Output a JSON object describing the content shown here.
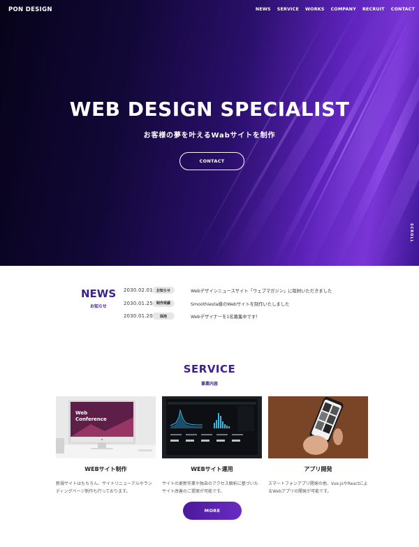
{
  "header": {
    "logo": "PON DESIGN",
    "nav": [
      "NEWS",
      "SERVICE",
      "WORKS",
      "COMPANY",
      "RECRUIT",
      "CONTACT"
    ]
  },
  "hero": {
    "title": "WEB DESIGN SPECIALIST",
    "subtitle": "お客様の夢を叶えるWabサイトを制作",
    "button": "CONTACT",
    "scroll": "SCROLL"
  },
  "news": {
    "title": "NEWS",
    "subtitle": "お知らせ",
    "items": [
      {
        "date": "2030.02.01",
        "tag": "お知らせ",
        "text": "Webデザインニュースサイト「ウェブマガジン」に取材いただきました"
      },
      {
        "date": "2030.01.25",
        "tag": "制作実績",
        "text": "Smoothiesta様のWebサイトを制作いたしました"
      },
      {
        "date": "2030.01.20",
        "tag": "採用",
        "text": "Webデザイナーを1名募集中です！"
      }
    ]
  },
  "service": {
    "title": "SERVICE",
    "subtitle": "事業内容",
    "cards": [
      {
        "image_text_1": "Web",
        "image_text_2": "Conference",
        "title": "WEBサイト制作",
        "text": "新規サイトはもちろん、サイトリニューアルやランディングページ制作も行っております。"
      },
      {
        "title": "WEBサイト運用",
        "text": "サイトの更新作業や独自のアクセス解析に基づいたサイト改善のご提案が可能です。"
      },
      {
        "title": "アプリ開発",
        "text": "スマートフォンアプリ開発の他、Vue.jsやReactによるWebアプリの開発が可能です。"
      }
    ],
    "more": "MORE"
  },
  "colors": {
    "accent": "#3d1e8e",
    "button_gradient": [
      "#4b1a9a",
      "#6a2bc4"
    ]
  }
}
